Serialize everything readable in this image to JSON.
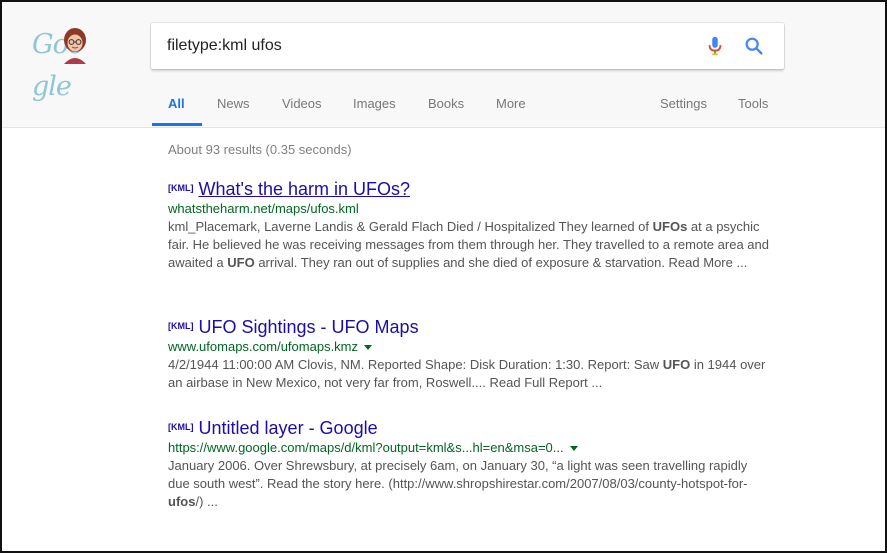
{
  "logo": {
    "text": "Goo gle"
  },
  "search": {
    "query": "filetype:kml ufos"
  },
  "tabs": [
    {
      "label": "All"
    },
    {
      "label": "News"
    },
    {
      "label": "Videos"
    },
    {
      "label": "Images"
    },
    {
      "label": "Books"
    },
    {
      "label": "More"
    },
    {
      "label": "Settings"
    },
    {
      "label": "Tools"
    }
  ],
  "stats": "About 93 results (0.35 seconds)",
  "results": [
    {
      "badge": "[KML]",
      "title": "What's the harm in UFOs?",
      "url": "whatstheharm.net/maps/ufos.kml",
      "snippet": [
        "kml_Placemark, Laverne Landis & Gerald Flach Died / Hospitalized They learned of ",
        "UFOs",
        " at a psychic fair. He believed he was receiving messages from them through her. They travelled to a remote area and awaited a ",
        "UFO",
        " arrival. They ran out of supplies and she died of exposure & starvation. Read More ..."
      ]
    },
    {
      "badge": "[KML]",
      "title": "UFO Sightings - UFO Maps",
      "url": "www.ufomaps.com/ufomaps.kmz",
      "snippet": [
        "4/2/1944 11:00:00 AM Clovis, NM. Reported Shape: Disk Duration: 1:30. Report: Saw ",
        "UFO",
        " in 1944 over an airbase in New Mexico, not very far from, Roswell.... Read Full Report ..."
      ]
    },
    {
      "badge": "[KML]",
      "title": "Untitled layer - Google",
      "url": "https://www.google.com/maps/d/kml?output=kml&s...hl=en&msa=0...",
      "snippet": [
        "January 2006. Over Shrewsbury, at precisely 6am, on January 30, “a light was seen travelling rapidly due south west”. Read the story here. (http://www.shropshirestar.com/2007/08/03/county-hotspot-for-",
        "ufos",
        "/) ..."
      ]
    }
  ]
}
